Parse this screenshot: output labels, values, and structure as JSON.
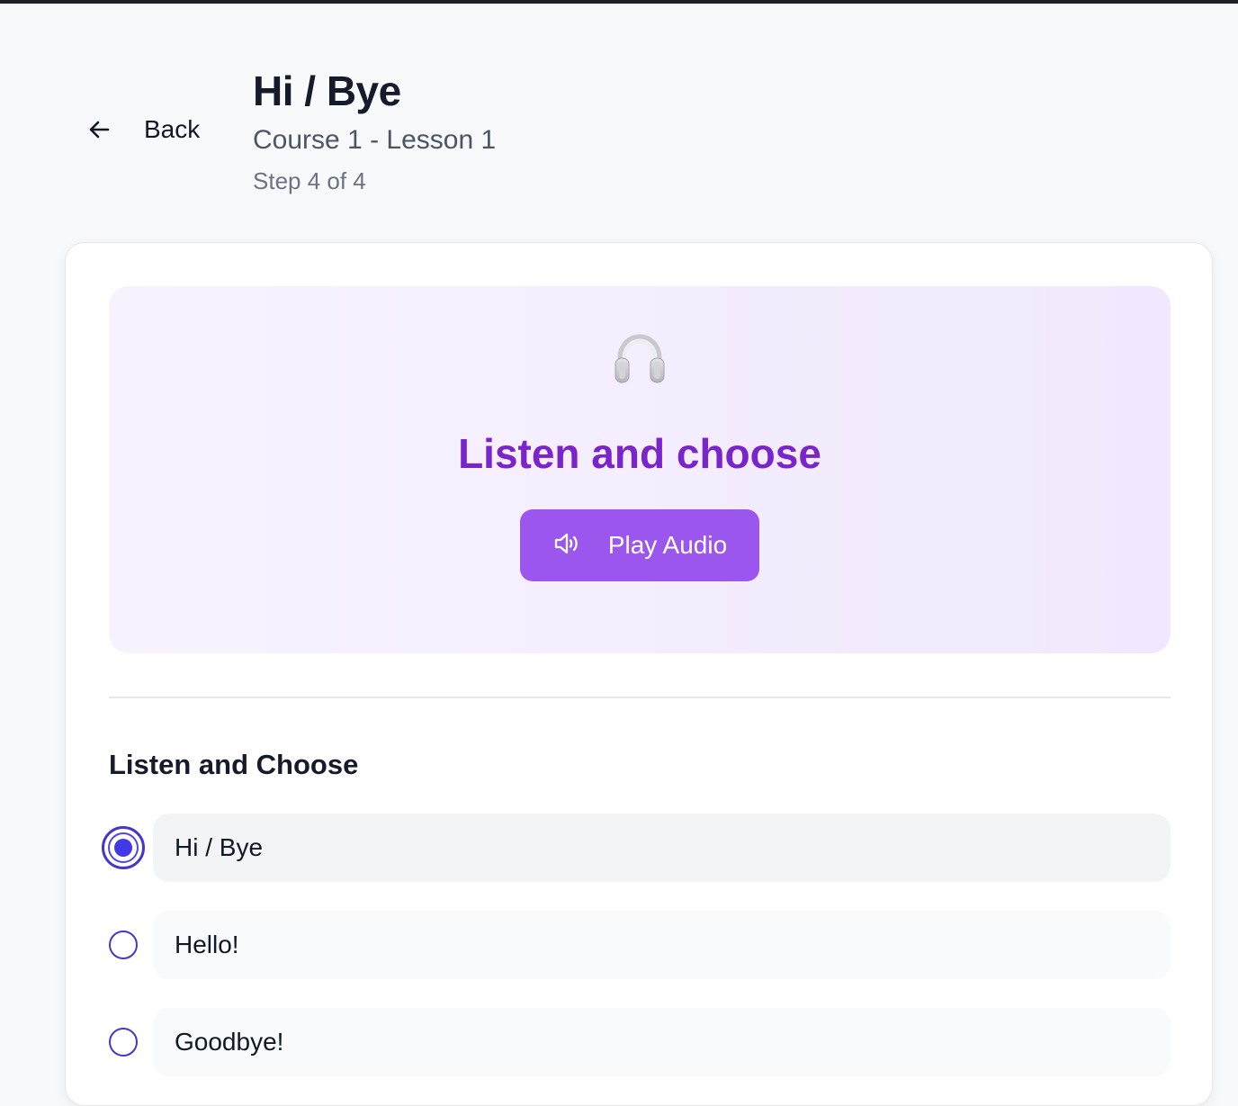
{
  "nav": {
    "back_label": "Back"
  },
  "header": {
    "title": "Hi / Bye",
    "subtitle": "Course 1 - Lesson 1",
    "step": "Step 4 of 4"
  },
  "exercise": {
    "icon": "headphones-icon",
    "title": "Listen and choose",
    "play_label": "Play Audio",
    "play_icon": "speaker-icon",
    "question": "Listen and Choose",
    "options": [
      {
        "label": "Hi / Bye",
        "selected": true
      },
      {
        "label": "Hello!",
        "selected": false
      },
      {
        "label": "Goodbye!",
        "selected": false
      }
    ]
  },
  "colors": {
    "accent": "#9b56ee",
    "title_purple": "#7a24cc",
    "radio": "#4338ca"
  }
}
